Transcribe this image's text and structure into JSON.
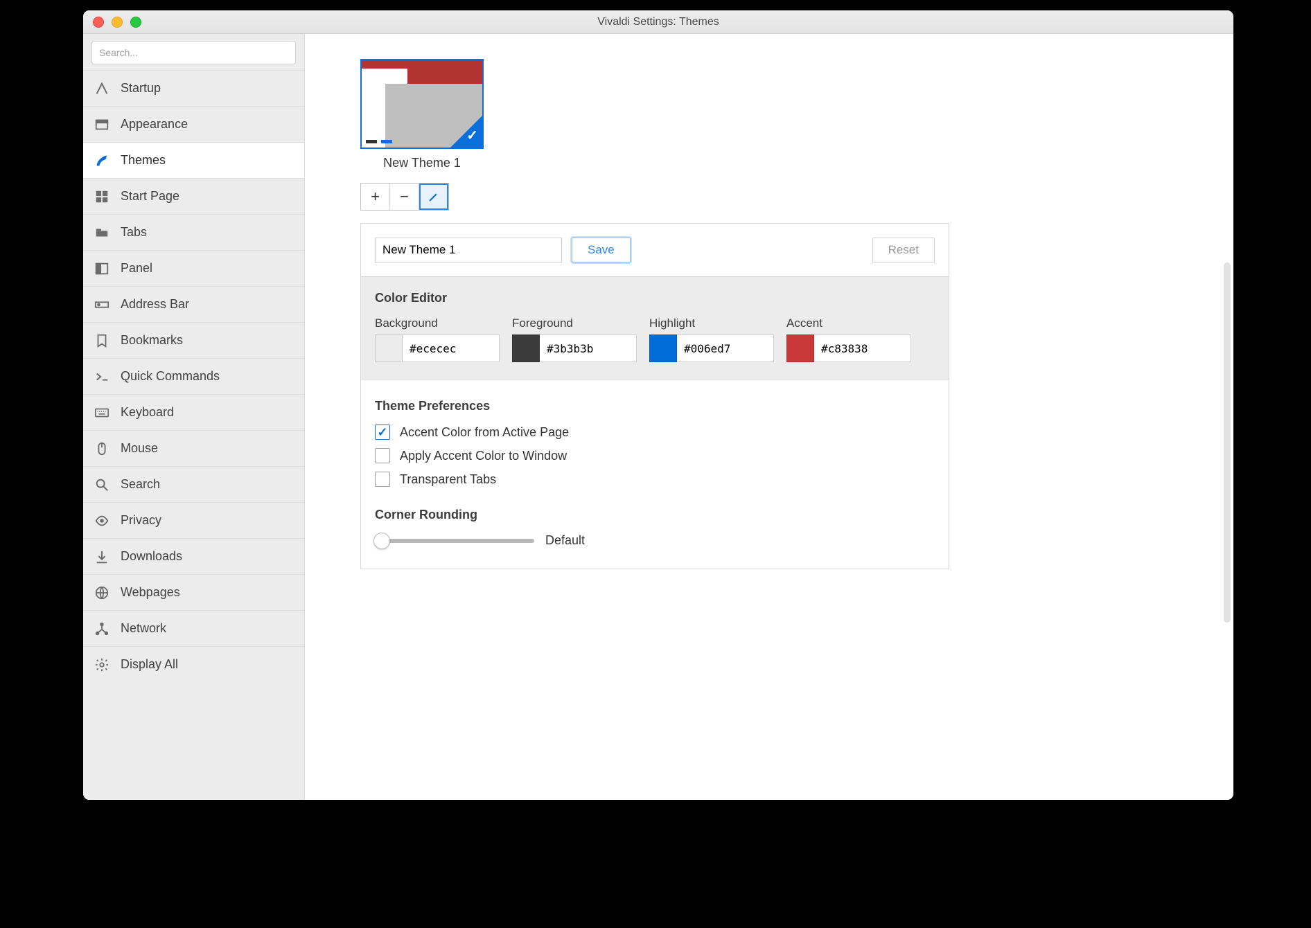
{
  "window": {
    "title": "Vivaldi Settings: Themes"
  },
  "search": {
    "placeholder": "Search..."
  },
  "sidebar": {
    "items": [
      {
        "id": "startup",
        "label": "Startup"
      },
      {
        "id": "appearance",
        "label": "Appearance"
      },
      {
        "id": "themes",
        "label": "Themes"
      },
      {
        "id": "start-page",
        "label": "Start Page"
      },
      {
        "id": "tabs",
        "label": "Tabs"
      },
      {
        "id": "panel",
        "label": "Panel"
      },
      {
        "id": "address-bar",
        "label": "Address Bar"
      },
      {
        "id": "bookmarks",
        "label": "Bookmarks"
      },
      {
        "id": "quick-commands",
        "label": "Quick Commands"
      },
      {
        "id": "keyboard",
        "label": "Keyboard"
      },
      {
        "id": "mouse",
        "label": "Mouse"
      },
      {
        "id": "search",
        "label": "Search"
      },
      {
        "id": "privacy",
        "label": "Privacy"
      },
      {
        "id": "downloads",
        "label": "Downloads"
      },
      {
        "id": "webpages",
        "label": "Webpages"
      },
      {
        "id": "network",
        "label": "Network"
      },
      {
        "id": "display-all",
        "label": "Display All"
      }
    ],
    "active": "themes"
  },
  "theme": {
    "name": "New Theme 1",
    "buttons": {
      "save": "Save",
      "reset": "Reset"
    }
  },
  "colorEditor": {
    "heading": "Color Editor",
    "fields": {
      "background": {
        "label": "Background",
        "value": "#ececec"
      },
      "foreground": {
        "label": "Foreground",
        "value": "#3b3b3b"
      },
      "highlight": {
        "label": "Highlight",
        "value": "#006ed7"
      },
      "accent": {
        "label": "Accent",
        "value": "#c83838"
      }
    }
  },
  "preferences": {
    "heading": "Theme Preferences",
    "items": [
      {
        "id": "accent-from-page",
        "label": "Accent Color from Active Page",
        "checked": true
      },
      {
        "id": "accent-to-window",
        "label": "Apply Accent Color to Window",
        "checked": false
      },
      {
        "id": "transparent-tabs",
        "label": "Transparent Tabs",
        "checked": false
      }
    ]
  },
  "cornerRounding": {
    "heading": "Corner Rounding",
    "valueLabel": "Default"
  }
}
